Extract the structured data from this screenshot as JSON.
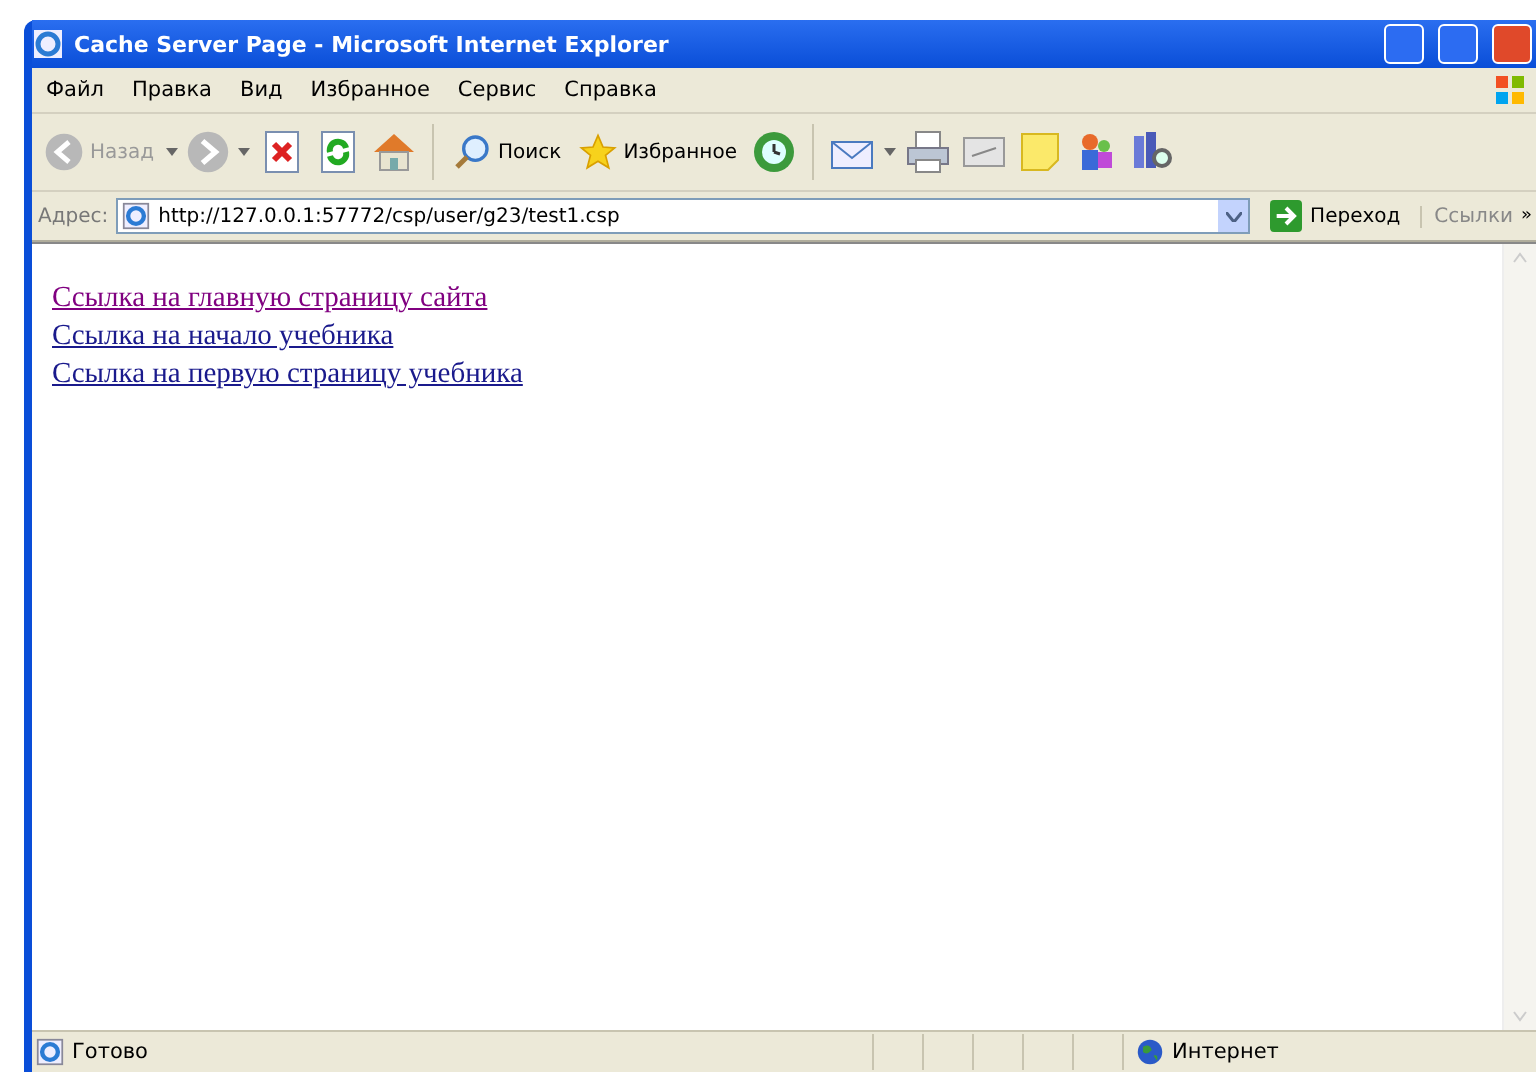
{
  "window": {
    "title": "Cache Server Page - Microsoft Internet Explorer"
  },
  "menu": [
    "Файл",
    "Правка",
    "Вид",
    "Избранное",
    "Сервис",
    "Справка"
  ],
  "toolbar": {
    "back": "Назад",
    "search": "Поиск",
    "favorites": "Избранное"
  },
  "address_bar": {
    "label": "Адрес:",
    "value": "http://127.0.0.1:57772/csp/user/g23/test1.csp",
    "go": "Переход",
    "links": "Ссылки",
    "more": "»"
  },
  "links": [
    {
      "text": "Ссылка на главную страницу сайта",
      "visited": true
    },
    {
      "text": "Ссылка на начало учебника",
      "visited": false
    },
    {
      "text": "Ссылка на первую страницу учебника",
      "visited": false
    }
  ],
  "status_bar": {
    "text": "Готово",
    "zone": "Интернет"
  }
}
